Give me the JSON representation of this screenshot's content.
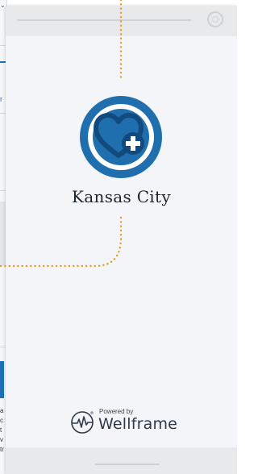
{
  "background_page": {
    "top_icon": "⌄",
    "partial_label": "r",
    "snippets": [
      "a",
      "c",
      "t",
      "v",
      "tr"
    ]
  },
  "splash": {
    "brand_name": "Kansas City",
    "powered_by": "Powered by",
    "vendor": "Wellframe"
  },
  "colors": {
    "connector": "#e69a28",
    "logo_blue": "#1f6fae",
    "logo_navy": "#124a7d",
    "screen_bg": "#f3f5f8"
  },
  "icons": {
    "logo": "heart-plus-icon",
    "vendor": "wellframe-pulse-icon",
    "camera": "camera-icon"
  }
}
